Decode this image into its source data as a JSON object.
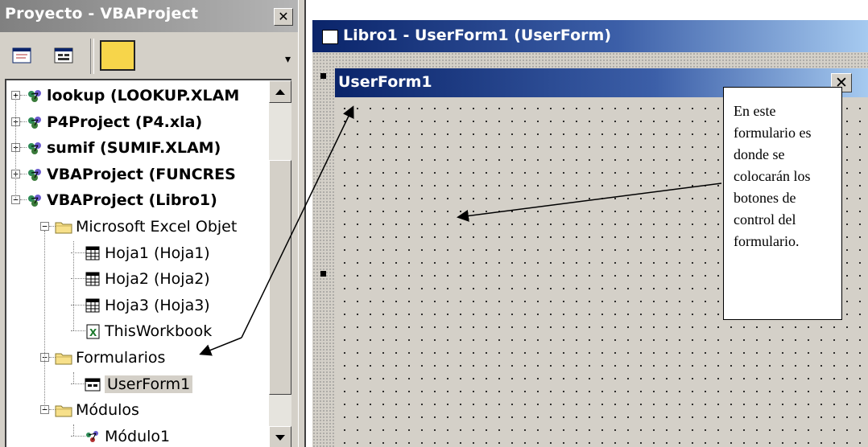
{
  "project_explorer": {
    "title": "Proyecto - VBAProject",
    "close_glyph": "✕",
    "toolbar": {
      "buttons": [
        {
          "name": "view-code-icon"
        },
        {
          "name": "view-object-icon"
        },
        {
          "name": "toggle-folders-icon"
        }
      ],
      "more_glyph": "▾"
    },
    "tree": [
      {
        "label": "lookup (LOOKUP.XLAM",
        "bold": true,
        "expander": "+",
        "icon": "vba-project-icon"
      },
      {
        "label": "P4Project (P4.xla)",
        "bold": true,
        "expander": "+",
        "icon": "vba-project-icon"
      },
      {
        "label": "sumif (SUMIF.XLAM)",
        "bold": true,
        "expander": "+",
        "icon": "vba-project-icon"
      },
      {
        "label": "VBAProject (FUNCRES",
        "bold": true,
        "expander": "+",
        "icon": "vba-project-icon"
      },
      {
        "label": "VBAProject (Libro1)",
        "bold": true,
        "expander": "−",
        "icon": "vba-project-icon"
      },
      {
        "label": "Microsoft Excel Objet",
        "expander": "−",
        "icon": "folder-icon"
      },
      {
        "label": "Hoja1 (Hoja1)",
        "icon": "worksheet-icon"
      },
      {
        "label": "Hoja2 (Hoja2)",
        "icon": "worksheet-icon"
      },
      {
        "label": "Hoja3 (Hoja3)",
        "icon": "worksheet-icon"
      },
      {
        "label": "ThisWorkbook",
        "icon": "workbook-icon"
      },
      {
        "label": "Formularios",
        "expander": "−",
        "icon": "folder-icon"
      },
      {
        "label": "UserForm1",
        "icon": "userform-icon",
        "selected": true
      },
      {
        "label": "Módulos",
        "expander": "−",
        "icon": "folder-icon"
      },
      {
        "label": "Módulo1",
        "icon": "module-icon"
      }
    ]
  },
  "designer_window": {
    "title": "Libro1 - UserForm1 (UserForm)"
  },
  "userform": {
    "caption": "UserForm1",
    "close_glyph": "✕"
  },
  "callout": {
    "lines": [
      "En este",
      "formulario es",
      "donde se",
      "colocarán los",
      "botones de",
      "control del",
      "formulario."
    ]
  },
  "colors": {
    "active_title_start": "#0a246a",
    "active_title_end": "#a6caf0",
    "inactive_title": "#808080",
    "face": "#d4d0c8"
  }
}
